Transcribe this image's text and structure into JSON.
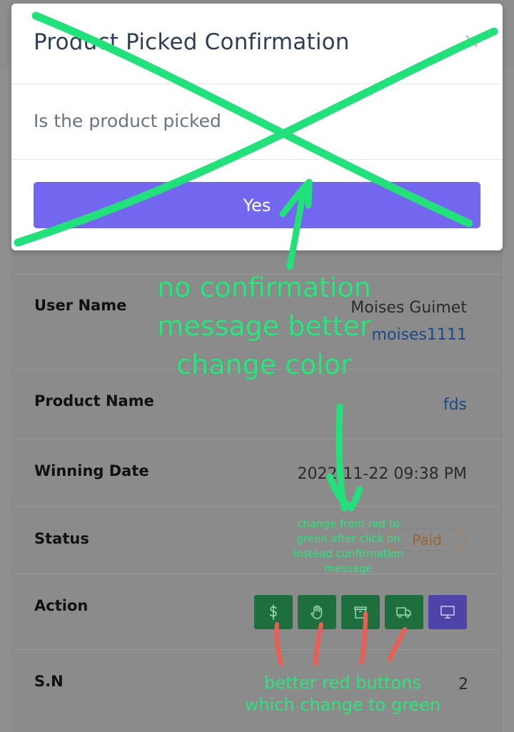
{
  "modal": {
    "title": "Product Picked Confirmation",
    "close": "×",
    "message": "Is the product picked",
    "confirm_label": "Yes"
  },
  "details": {
    "user_name_label": "User Name",
    "user_name": "Moises Guimet",
    "user_handle": "moises1111",
    "product_name_label": "Product Name",
    "product_name": "fds",
    "winning_date_label": "Winning Date",
    "winning_date": "2022-11-22 09:38 PM",
    "status_label": "Status",
    "status": "Paid",
    "action_label": "Action",
    "sn_label": "S.N",
    "sn": "2"
  },
  "actions": [
    {
      "icon": "dollar-icon",
      "color": "#1f6f3e"
    },
    {
      "icon": "hand-icon",
      "color": "#1f6f3e"
    },
    {
      "icon": "box-icon",
      "color": "#1f6f3e"
    },
    {
      "icon": "truck-icon",
      "color": "#1f6f3e"
    },
    {
      "icon": "monitor-icon",
      "color": "#4e43a8"
    }
  ],
  "annotations": {
    "main_line1": "no confirmation",
    "main_line2": "message better",
    "main_line3": "change color",
    "status_note_line1": "change from red to",
    "status_note_line2": "green after click on",
    "status_note_line3": "instead confirmation",
    "status_note_line4": "message",
    "buttons_note_line1": "better red buttons",
    "buttons_note_line2": "which change to green",
    "colors": {
      "green_marker": "#2ee37e",
      "red_marker": "#ef5d52"
    }
  }
}
